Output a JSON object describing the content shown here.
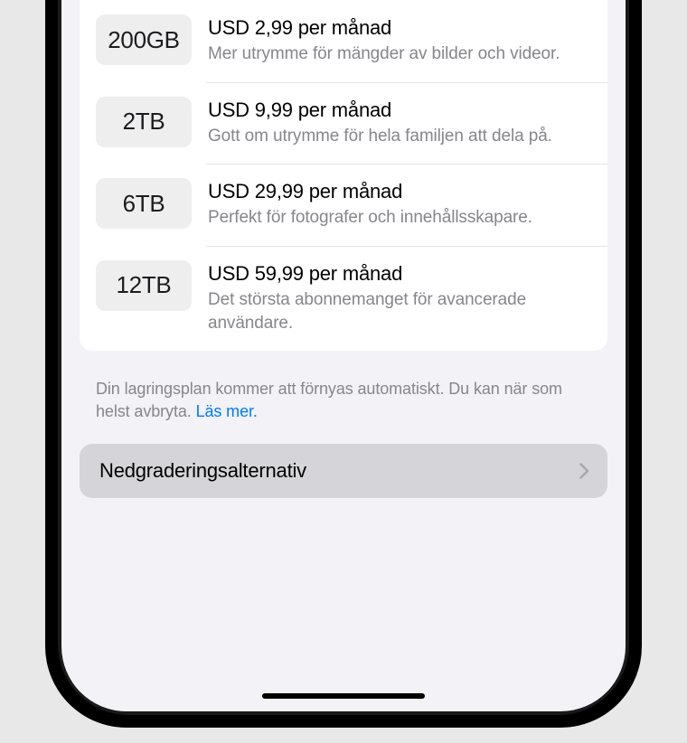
{
  "plans": [
    {
      "size": "200GB",
      "price": "USD 2,99 per månad",
      "description": "Mer utrymme för mängder av bilder och videor."
    },
    {
      "size": "2TB",
      "price": "USD 9,99 per månad",
      "description": "Gott om utrymme för hela familjen att dela på."
    },
    {
      "size": "6TB",
      "price": "USD 29,99 per månad",
      "description": "Perfekt för fotografer och innehållsskapare."
    },
    {
      "size": "12TB",
      "price": "USD 59,99 per månad",
      "description": "Det största abonnemanget för avancerade användare."
    }
  ],
  "renewal": {
    "text": "Din lagringsplan kommer att förnyas automatiskt. Du kan när som helst avbryta. ",
    "link": "Läs mer."
  },
  "downgrade": {
    "label": "Nedgraderingsalternativ"
  }
}
